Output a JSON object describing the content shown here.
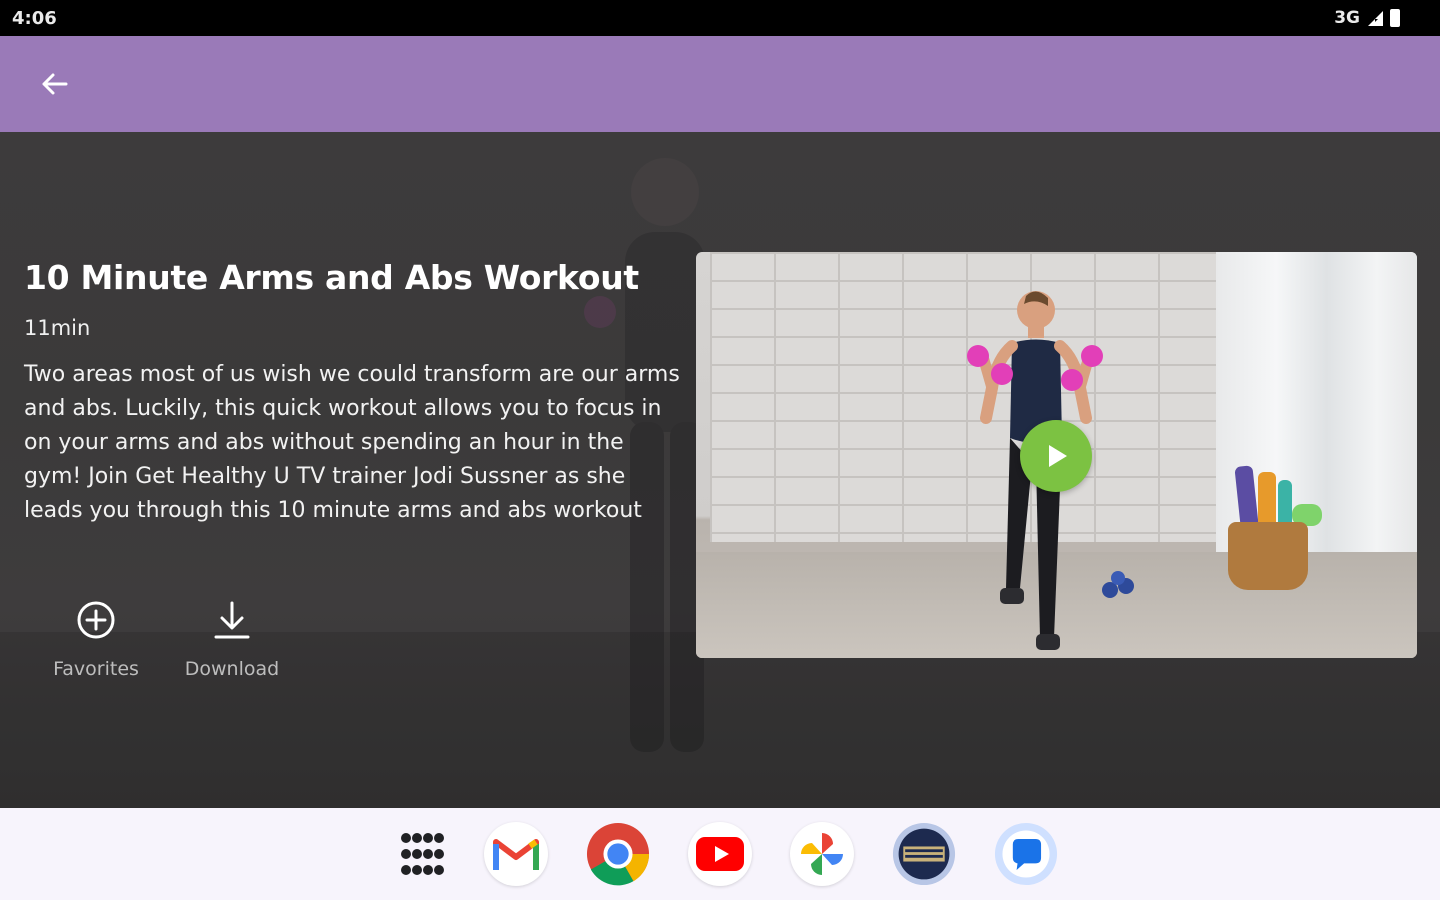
{
  "status_bar": {
    "time": "4:06",
    "network": "3G"
  },
  "app_bar": {
    "background": "#9a7ab8",
    "back_icon": "arrow-back-icon"
  },
  "workout": {
    "title": "10 Minute Arms and Abs Workout",
    "duration": "11min",
    "description": "Two areas most of us wish we could transform are our arms and abs. Luckily, this quick workout allows you to focus in on your arms and abs without spending an hour in the gym! Join Get Healthy U TV trainer Jodi Sussner as she leads you through this 10 minute arms and abs workout"
  },
  "actions": {
    "favorites_label": "Favorites",
    "favorites_icon": "add-circle-icon",
    "download_label": "Download",
    "download_icon": "download-icon"
  },
  "video": {
    "play_icon": "play-icon",
    "play_color": "#7cc242"
  },
  "taskbar": {
    "apps": [
      "app-drawer",
      "gmail",
      "chrome",
      "youtube",
      "photos",
      "news-app",
      "messages"
    ]
  }
}
